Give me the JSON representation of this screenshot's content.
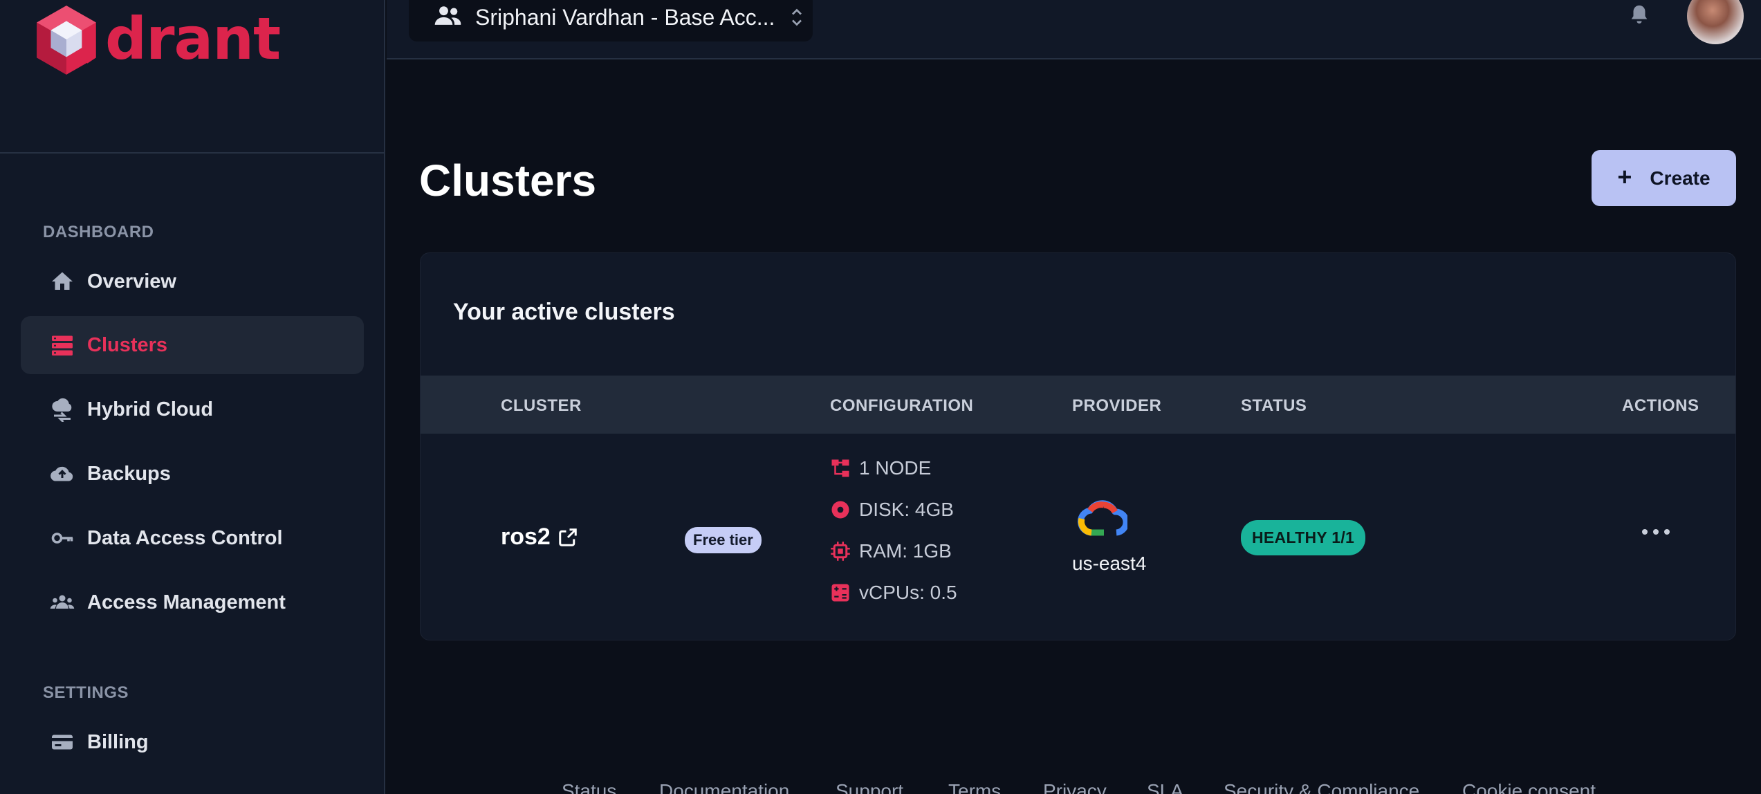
{
  "brand": {
    "logo_text": "drant",
    "accent": "#dc244c"
  },
  "topbar": {
    "account_name": "Sriphani Vardhan - Base Acc...",
    "icons": [
      "people-icon",
      "updown-chevron-icon",
      "bell-icon"
    ]
  },
  "sidebar": {
    "sections": [
      {
        "label": "DASHBOARD",
        "items": [
          {
            "label": "Overview",
            "icon": "home-icon",
            "active": false
          },
          {
            "label": "Clusters",
            "icon": "clusters-icon",
            "active": true
          },
          {
            "label": "Hybrid Cloud",
            "icon": "hybrid-cloud-icon",
            "active": false
          },
          {
            "label": "Backups",
            "icon": "cloud-upload-icon",
            "active": false
          },
          {
            "label": "Data Access Control",
            "icon": "key-icon",
            "active": false
          },
          {
            "label": "Access Management",
            "icon": "users-icon",
            "active": false
          }
        ]
      },
      {
        "label": "SETTINGS",
        "items": [
          {
            "label": "Billing",
            "icon": "credit-card-icon",
            "active": false
          }
        ]
      }
    ]
  },
  "main": {
    "title": "Clusters",
    "create_label": "Create",
    "card_title": "Your active clusters",
    "table": {
      "columns": [
        "CLUSTER",
        "CONFIGURATION",
        "PROVIDER",
        "STATUS",
        "ACTIONS"
      ],
      "rows": [
        {
          "name": "ros2",
          "tier": "Free tier",
          "config": [
            "1 NODE",
            "DISK: 4GB",
            "RAM: 1GB",
            "vCPUs: 0.5"
          ],
          "provider_icon": "google-cloud-icon",
          "region": "us-east4",
          "status": "HEALTHY 1/1",
          "status_color": "#19b39a"
        }
      ]
    }
  },
  "footer": {
    "links": [
      "Status",
      "Documentation",
      "Support",
      "Terms",
      "Privacy",
      "SLA",
      "Security & Compliance",
      "Cookie consent"
    ]
  }
}
